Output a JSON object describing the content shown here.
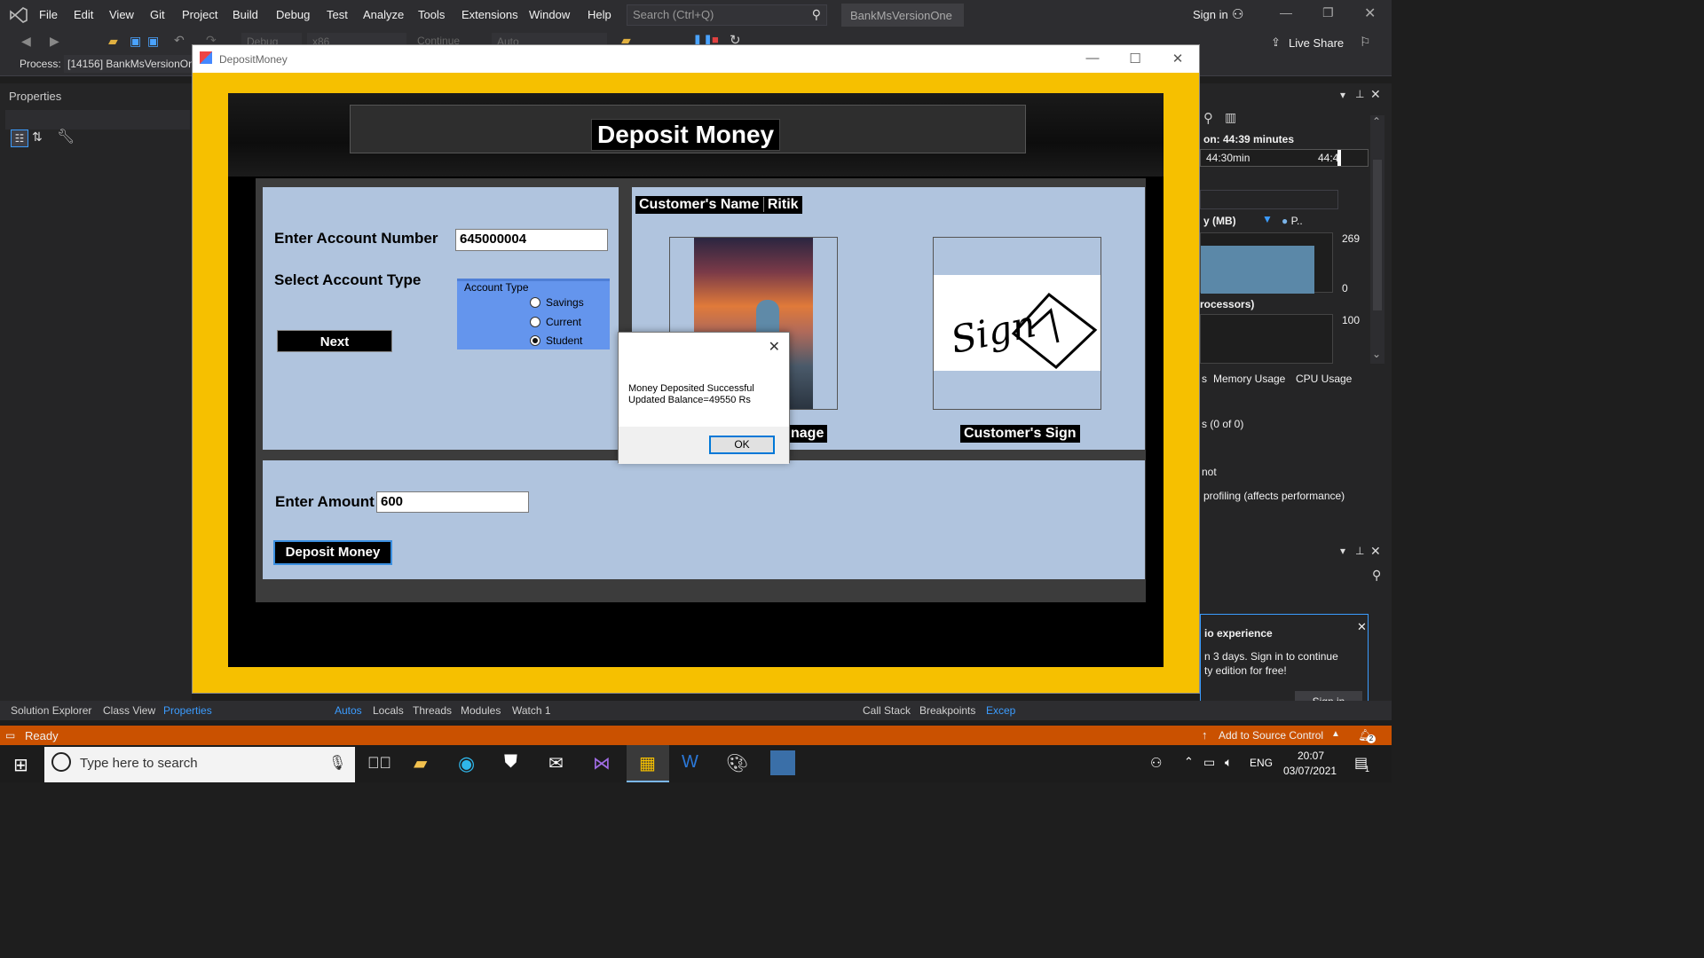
{
  "vs": {
    "menu": [
      "File",
      "Edit",
      "View",
      "Git",
      "Project",
      "Build",
      "Debug",
      "Test",
      "Analyze",
      "Tools",
      "Extensions",
      "Window",
      "Help"
    ],
    "search_placeholder": "Search (Ctrl+Q)",
    "solution_name": "BankMsVersionOne",
    "sign_in": "Sign in",
    "live_share": "Live Share",
    "toolbar": {
      "config": "Debug",
      "platform": "x86",
      "continue": "Continue",
      "auto": "Auto"
    },
    "process_label": "Process:",
    "process_value": "[14156] BankMsVersionOn",
    "properties_title": "Properties",
    "diag": {
      "duration": "on: 44:39 minutes",
      "t1": "44:30min",
      "t2": "44:4",
      "mem_label": "y (MB)",
      "mem_legend": "P..",
      "mem_max": "269",
      "mem_min": "0",
      "cpu_label": "rocessors)",
      "cpu_max": "100",
      "tab_memory": "Memory Usage",
      "tab_cpu": "CPU Usage",
      "tab_prefix": "s",
      "count": "s (0 of 0)",
      "line_not": "not",
      "line_profiling": "profiling (affects performance)",
      "notif_title": "io experience",
      "notif_body1": "n 3 days. Sign in to continue",
      "notif_body2": "ty edition for free!",
      "notif_btn": "Sign in"
    },
    "bottom_left_tabs": [
      "Solution Explorer",
      "Class View",
      "Properties"
    ],
    "bottom_mid_tabs": [
      "Autos",
      "Locals",
      "Threads",
      "Modules",
      "Watch 1"
    ],
    "bottom_right_tabs": [
      "Call Stack",
      "Breakpoints",
      "Excep"
    ],
    "status": "Ready",
    "source_control": "Add to Source Control",
    "notif_count": "2"
  },
  "taskbar": {
    "search_placeholder": "Type here to search",
    "lang": "ENG",
    "time": "20:07",
    "date": "03/07/2021",
    "notif_badge": "1"
  },
  "app": {
    "window_title": "DepositMoney",
    "heading": "Deposit Money",
    "account_label": "Enter Account Number",
    "account_value": "645000004",
    "type_label": "Select Account Type",
    "group_legend": "Account Type",
    "radios": [
      {
        "label": "Savings",
        "checked": false
      },
      {
        "label": "Current",
        "checked": false
      },
      {
        "label": "Student",
        "checked": true
      }
    ],
    "next_button": "Next",
    "customer_name_label": "Customer's Name",
    "customer_name_value": "Ritik",
    "image_label_partial": "nage",
    "sign_label": "Customer's Sign",
    "sign_text": "Sign",
    "amount_label": "Enter Amount",
    "amount_value": "600",
    "deposit_button": "Deposit Money"
  },
  "dialog": {
    "message": "Money Deposited Successful\nUpdated Balance=49550 Rs",
    "ok": "OK"
  },
  "colors": {
    "window_bg": "#f6c000",
    "panel_bg": "#b0c4de",
    "group_bg": "#6495ed",
    "status_bar": "#ca5100"
  }
}
